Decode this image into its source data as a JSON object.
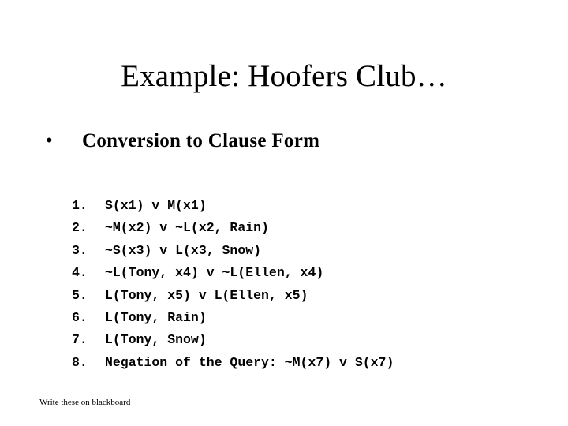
{
  "slide": {
    "title": "Example: Hoofers Club…",
    "bullet": {
      "marker": "•",
      "text": "Conversion to Clause Form"
    },
    "clauses": [
      {
        "num": "1.",
        "text": "S(x1) v M(x1)"
      },
      {
        "num": "2.",
        "text": "~M(x2) v ~L(x2, Rain)"
      },
      {
        "num": "3.",
        "text": "~S(x3) v L(x3, Snow)"
      },
      {
        "num": "4.",
        "text": "~L(Tony, x4) v ~L(Ellen, x4)"
      },
      {
        "num": "5.",
        "text": "L(Tony, x5) v L(Ellen, x5)"
      },
      {
        "num": "6.",
        "text": "L(Tony, Rain)"
      },
      {
        "num": "7.",
        "text": "L(Tony, Snow)"
      },
      {
        "num": "8.",
        "text": "Negation of the Query: ~M(x7) v S(x7)"
      }
    ],
    "footer_note": "Write these on blackboard"
  }
}
